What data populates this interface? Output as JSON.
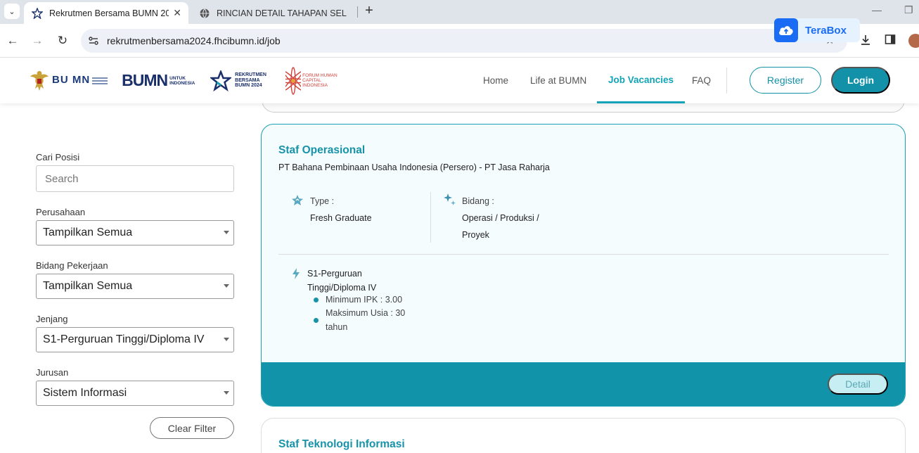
{
  "browser": {
    "tabs": [
      {
        "title": "Rekrutmen Bersama BUMN 202",
        "active": true
      },
      {
        "title": "RINCIAN DETAIL TAHAPAN SEL",
        "active": false
      }
    ],
    "url": "rekrutmenbersama2024.fhcibumn.id/job",
    "extension": {
      "name": "TeraBox"
    }
  },
  "header": {
    "logos": {
      "bumn_stack": "BU MN",
      "bumn_main": "BUMN",
      "bumn_sub": "UNTUK INDONESIA",
      "rekrutmen": "REKRUTMEN BERSAMA BUMN 2024",
      "forum": "FORUM HUMAN CAPITAL INDONESIA"
    },
    "nav": [
      {
        "label": "Home"
      },
      {
        "label": "Life at BUMN"
      },
      {
        "label": "Job Vacancies",
        "active": true
      },
      {
        "label": "FAQ"
      }
    ],
    "register_label": "Register",
    "login_label": "Login"
  },
  "filters": {
    "search_label": "Cari Posisi",
    "search_placeholder": "Search",
    "company_label": "Perusahaan",
    "company_value": "Tampilkan Semua",
    "field_label": "Bidang Pekerjaan",
    "field_value": "Tampilkan Semua",
    "level_label": "Jenjang",
    "level_value": "S1-Perguruan Tinggi/Diploma IV",
    "major_label": "Jurusan",
    "major_value": "Sistem Informasi",
    "clear_label": "Clear Filter"
  },
  "jobs": [
    {
      "title": "Staf Operasional",
      "company": "PT Bahana Pembinaan Usaha Indonesia (Persero) - PT Jasa Raharja",
      "type_label": "Type :",
      "type_value": "Fresh Graduate",
      "field_label": "Bidang :",
      "field_value_1": "Operasi / Produksi /",
      "field_value_2": "Proyek",
      "education_1": "S1-Perguruan",
      "education_2": "Tinggi/Diploma IV",
      "req_ipk": "Minimum IPK : 3.00",
      "req_age_1": "Maksimum Usia : 30",
      "req_age_2": "tahun",
      "detail_label": "Detail"
    },
    {
      "title": "Staf Teknologi Informasi"
    }
  ],
  "colors": {
    "accent": "#1391a8",
    "card_bg": "#f4fcfd",
    "terabox": "#1a6cf5"
  }
}
